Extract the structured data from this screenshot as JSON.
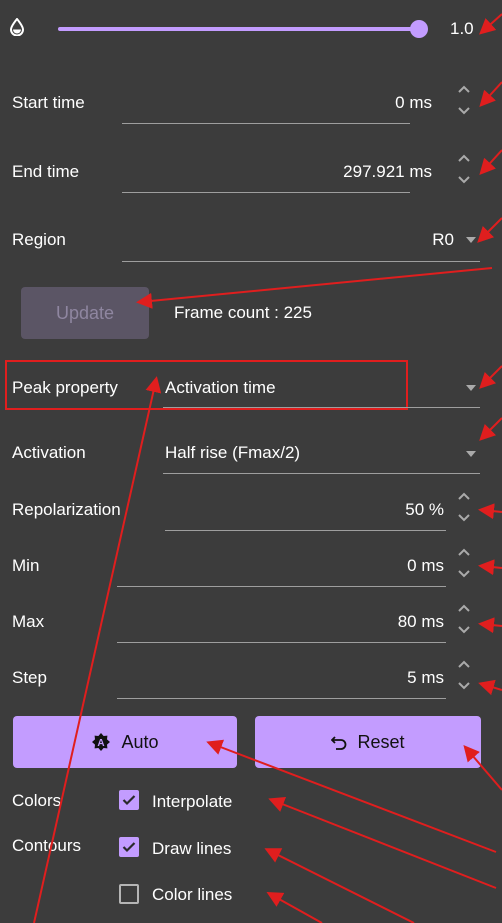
{
  "opacity_slider": {
    "icon": "opacity-drop-icon",
    "value_label": "1.0",
    "value": 1.0
  },
  "fields": {
    "start_time": {
      "label": "Start time",
      "value": "0 ms"
    },
    "end_time": {
      "label": "End time",
      "value": "297.921 ms"
    },
    "region": {
      "label": "Region",
      "value": "R0"
    }
  },
  "update": {
    "button_label": "Update",
    "frame_count": "Frame count : 225"
  },
  "peak_property": {
    "label": "Peak property",
    "value": "Activation time"
  },
  "activation": {
    "label": "Activation",
    "value": "Half rise (Fmax/2)"
  },
  "repolarization": {
    "label": "Repolarization",
    "value": "50 %"
  },
  "min": {
    "label": "Min",
    "value": "0 ms"
  },
  "max": {
    "label": "Max",
    "value": "80 ms"
  },
  "step": {
    "label": "Step",
    "value": "5 ms"
  },
  "buttons": {
    "auto": {
      "label": "Auto",
      "icon": "auto-icon"
    },
    "reset": {
      "label": "Reset",
      "icon": "undo-icon"
    }
  },
  "colors": {
    "label": "Colors",
    "checkbox_label": "Interpolate",
    "checked": true
  },
  "contours": {
    "label": "Contours",
    "draw_lines": {
      "label": "Draw lines",
      "checked": true
    },
    "color_lines": {
      "label": "Color lines",
      "checked": false
    }
  },
  "theme": {
    "accent": "#c39cff",
    "background": "#3c3c3c",
    "annotation": "#e01e1e"
  }
}
